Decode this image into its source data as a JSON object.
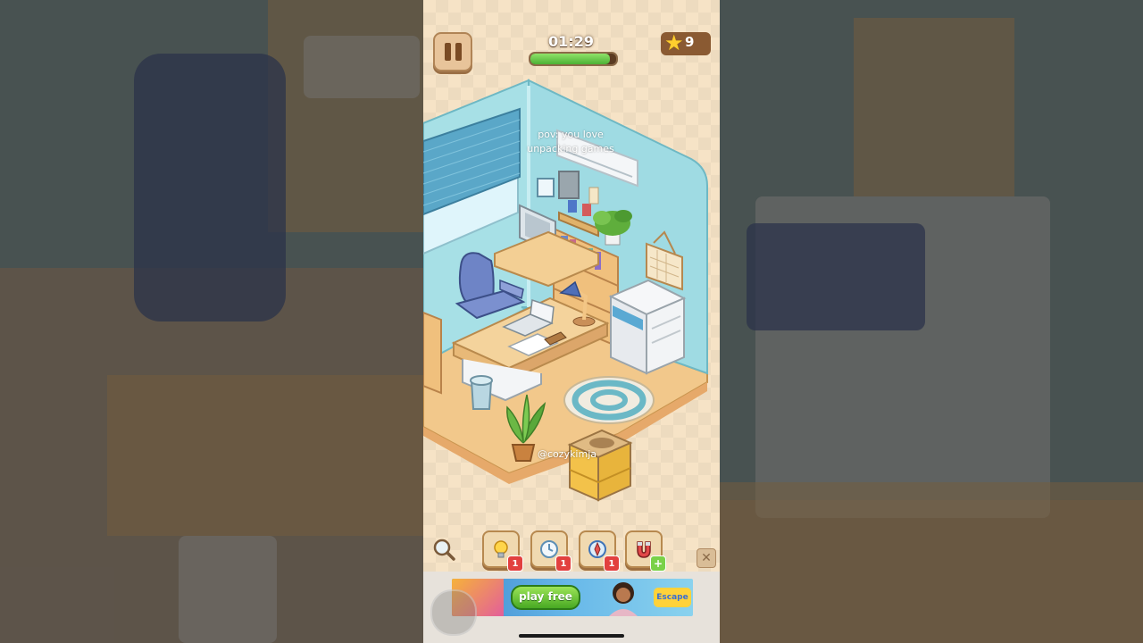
{
  "hud": {
    "timer": "01:29",
    "time_remaining_fraction": 0.93,
    "stars_count": "9",
    "pause_icon": "pause-icon",
    "star_icon": "star-icon"
  },
  "overlay": {
    "caption": "pov: you love unpacking games",
    "watermark": "@cozykimja"
  },
  "room_items": [
    "window-blind",
    "air-conditioner",
    "computer-monitor",
    "keyboard",
    "office-chair",
    "desk",
    "desk-lamp",
    "bookshelf",
    "potted-plant",
    "printer",
    "trash-bin",
    "round-rug",
    "wall-calendar",
    "cardboard-box"
  ],
  "tools": [
    {
      "name": "hint",
      "icon": "lightbulb-icon",
      "badge": "1"
    },
    {
      "name": "freeze",
      "icon": "clock-icon",
      "badge": "1"
    },
    {
      "name": "compass",
      "icon": "compass-icon",
      "badge": "1"
    },
    {
      "name": "magnet",
      "icon": "magnet-icon",
      "badge": "+"
    }
  ],
  "ad": {
    "cta": "play free",
    "logo_text": "Escape"
  },
  "colors": {
    "background": "#f6e3c6",
    "wall": "#9fdbe3",
    "floor": "#f1c98a",
    "timer_fill": "#4cb135",
    "badge": "#e2403f"
  }
}
